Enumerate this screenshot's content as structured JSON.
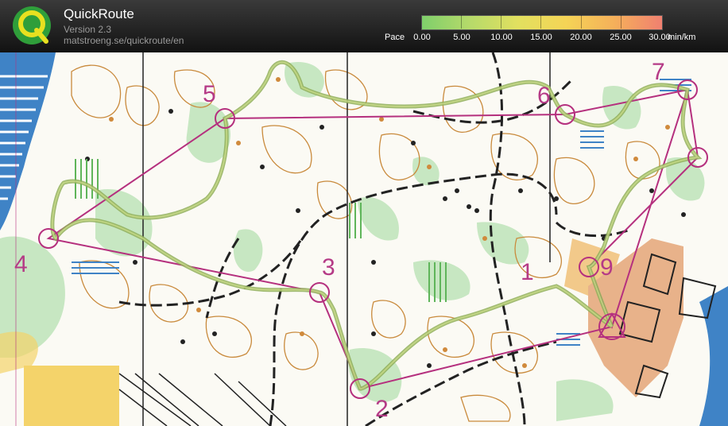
{
  "app": {
    "title": "QuickRoute",
    "version": "Version 2.3",
    "url": "matstroeng.se/quickroute/en"
  },
  "pace_scale": {
    "label": "Pace",
    "unit": "min/km",
    "ticks": [
      "0.00",
      "5.00",
      "10.00",
      "15.00",
      "20.00",
      "25.00",
      "30.00"
    ],
    "colors": [
      "#7fcf6b",
      "#b6da6a",
      "#e2e05f",
      "#f5d456",
      "#f5b05a",
      "#f08070"
    ]
  },
  "map": {
    "controls": [
      {
        "number": "1"
      },
      {
        "number": "2"
      },
      {
        "number": "3"
      },
      {
        "number": "4"
      },
      {
        "number": "5"
      },
      {
        "number": "6"
      },
      {
        "number": "7"
      },
      {
        "number": "8"
      },
      {
        "number": "9"
      }
    ],
    "course_color": "#b5307e",
    "route_color": "#8fae5a"
  }
}
